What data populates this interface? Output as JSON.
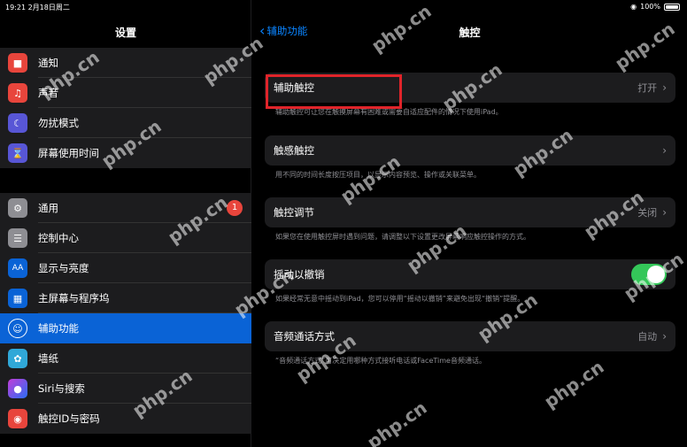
{
  "status_bar": {
    "time": "19:21  2月18日周二",
    "wifi": "wifi-icon",
    "battery_text": "100%"
  },
  "sidebar": {
    "title": "设置",
    "group1": [
      {
        "label": "通知",
        "icon": "notification-icon",
        "color": "#e8453c"
      },
      {
        "label": "声音",
        "icon": "speaker-icon",
        "color": "#e8453c"
      },
      {
        "label": "勿扰模式",
        "icon": "moon-icon",
        "color": "#5856d6"
      },
      {
        "label": "屏幕使用时间",
        "icon": "hourglass-icon",
        "color": "#5856d6"
      }
    ],
    "group2": [
      {
        "label": "通用",
        "icon": "gear-icon",
        "color": "#8e8e93",
        "badge": "1"
      },
      {
        "label": "控制中心",
        "icon": "toggles-icon",
        "color": "#8e8e93"
      },
      {
        "label": "显示与亮度",
        "icon": "text-size-icon",
        "color": "#0a63d6"
      },
      {
        "label": "主屏幕与程序坞",
        "icon": "grid-icon",
        "color": "#0a63d6"
      },
      {
        "label": "辅助功能",
        "icon": "accessibility-icon",
        "color": "#0a63d6",
        "active": true
      },
      {
        "label": "墙纸",
        "icon": "flower-icon",
        "color": "#30a8d8"
      },
      {
        "label": "Siri与搜索",
        "icon": "siri-icon",
        "color": "#333333"
      },
      {
        "label": "触控ID与密码",
        "icon": "fingerprint-icon",
        "color": "#e8453c"
      }
    ]
  },
  "main": {
    "back_label": "辅助功能",
    "title": "触控",
    "rows": [
      {
        "label": "辅助触控",
        "value": "打开",
        "footer": "辅助触控可让您在触摸屏幕有困难或需要自适应配件的情况下使用iPad。"
      },
      {
        "label": "触感触控",
        "value": "",
        "footer": "用不同的时间长度按压项目，以显示内容预览、操作或关联菜单。"
      },
      {
        "label": "触控调节",
        "value": "关闭",
        "footer": "如果您在使用触控屏时遇到问题，请调整以下设置更改屏幕响应触控操作的方式。"
      },
      {
        "label": "摇动以撤销",
        "value": "",
        "footer": "如果经常无意中摇动到iPad，您可以停用“摇动以撤销”来避免出现“撤销”提醒。",
        "toggle_on": true
      },
      {
        "label": "音频通话方式",
        "value": "自动",
        "footer": "“音频通话方式”可决定用哪种方式接听电话或FaceTime音频通话。"
      }
    ]
  },
  "watermark_text": "php.cn"
}
